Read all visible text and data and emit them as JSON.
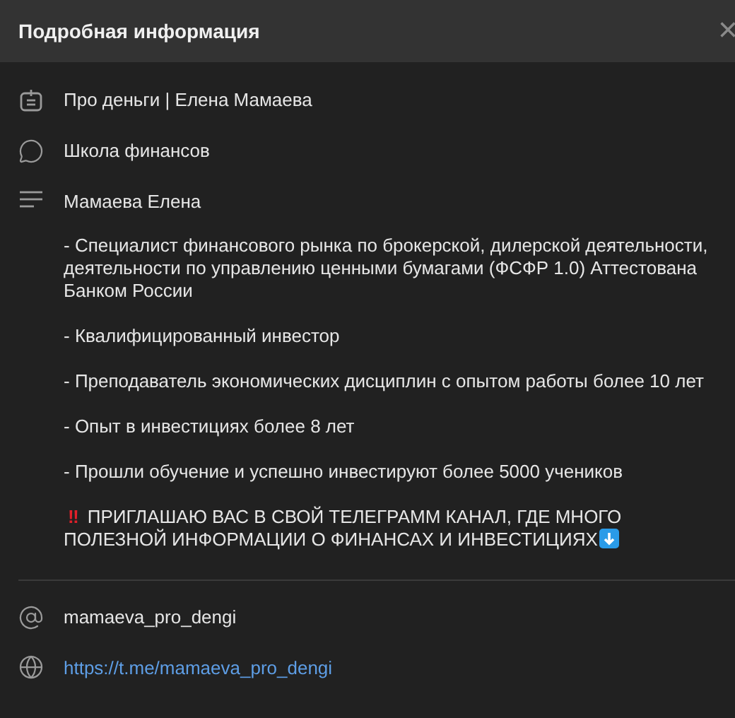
{
  "header": {
    "title": "Подробная информация",
    "close": "×"
  },
  "rows": [
    {
      "kind": "channel",
      "text": "Про деньги | Елена Мамаева"
    },
    {
      "kind": "chat",
      "text": "Школа финансов"
    },
    {
      "kind": "about",
      "text": "Мамаева Елена"
    }
  ],
  "description": [
    "- Специалист финансового рынка по брокерской, дилерской деятельности, деятельности по управлению ценными бумагами (ФСФР 1.0) Аттестована Банком России",
    "- Квалифицированный инвестор",
    "- Преподаватель экономических дисциплин с опытом работы более 10 лет",
    "- Опыт в инвестициях более 8 лет",
    "- Прошли обучение и успешно инвестируют более 5000 учеников"
  ],
  "invite": {
    "mark": "‼",
    "text": "ПРИГЛАШАЮ ВАС В СВОЙ ТЕЛЕГРАММ КАНАЛ, ГДЕ МНОГО ПОЛЕЗНОЙ ИНФОРМАЦИИ О ФИНАНСАХ И ИНВЕСТИЦИЯХ"
  },
  "links": [
    {
      "kind": "username",
      "text": "mamaeva_pro_dengi"
    },
    {
      "kind": "link",
      "text": "https://t.me/mamaeva_pro_dengi"
    }
  ]
}
